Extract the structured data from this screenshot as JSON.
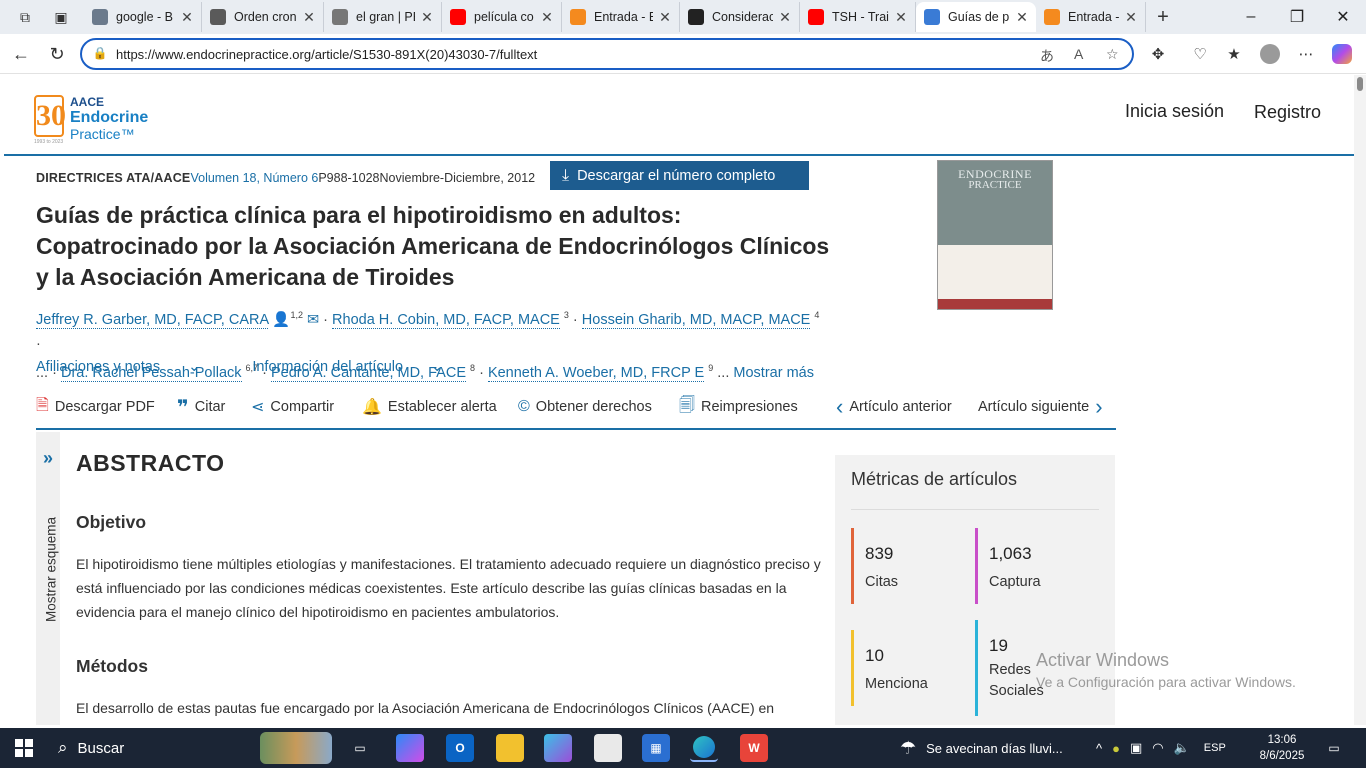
{
  "browser": {
    "tabs": [
      {
        "label": "google - B",
        "icon": "search-icon",
        "color": "#6b7a8c"
      },
      {
        "label": "Orden cron",
        "icon": "doc-icon",
        "color": "#5a5a5a"
      },
      {
        "label": "el gran | PE",
        "icon": "image-icon",
        "color": "#777777"
      },
      {
        "label": "película co",
        "icon": "youtube-icon",
        "color": "#ff0000"
      },
      {
        "label": "Entrada - E",
        "icon": "blogger-icon",
        "color": "#f48a1e"
      },
      {
        "label": "Considerac",
        "icon": "chatgpt-icon",
        "color": "#222222"
      },
      {
        "label": "TSH - Train",
        "icon": "youtube-icon",
        "color": "#ff0000"
      },
      {
        "label": "Guías de p",
        "icon": "aace-icon",
        "color": "#3a7bd5",
        "active": true
      },
      {
        "label": "Entrada - E",
        "icon": "blogger-icon",
        "color": "#f48a1e"
      }
    ],
    "url": "https://www.endocrinepractice.org/article/S1530-891X(20)43030-7/fulltext"
  },
  "site": {
    "logo_aace": "AACE",
    "logo_endocrine": "Endocrine",
    "logo_practice": "Practice™",
    "logo_num": "30",
    "logo_years": "1993 to 2023",
    "login": "Inicia sesión",
    "register": "Registro"
  },
  "article": {
    "type": "DIRECTRICES ATA/AACE",
    "volume": "Volumen 18, Número 6",
    "pages": "P988-1028",
    "date": "Noviembre-Diciembre, 2012",
    "download_issue": "Descargar el número completo",
    "cover_title": "ENDOCRINE",
    "cover_subtitle": "PRACTICE",
    "title": "Guías de práctica clínica para el hipotiroidismo en adultos: Copatrocinado por la Asociación Americana de Endocrinólogos Clínicos y la Asociación Americana de Tiroides",
    "authors": [
      {
        "name": "Jeffrey R. Garber, MD, FACP, CARA",
        "sup": "1,2"
      },
      {
        "name": "Rhoda H. Cobin, MD, FACP, MACE",
        "sup": "3"
      },
      {
        "name": "Hossein Gharib, MD, MACP, MACE",
        "sup": "4"
      },
      {
        "name": "Dra. Rachel Pessah-Pollack",
        "sup": "6,7"
      },
      {
        "name": "Pedro A. Cantante, MD, FACE",
        "sup": "8"
      },
      {
        "name": "Kenneth A. Woeber, MD, FRCP E",
        "sup": "9"
      }
    ],
    "more": "Mostrar más",
    "ellipsis": "...",
    "affiliations": "Afiliaciones y notas",
    "article_info": "Información del artículo"
  },
  "toolbar": {
    "pdf": "Descargar PDF",
    "cite": "Citar",
    "share": "Compartir",
    "alert": "Establecer alerta",
    "rights": "Obtener derechos",
    "reprints": "Reimpresiones",
    "prev": "Artículo anterior",
    "next": "Artículo siguiente"
  },
  "outline": {
    "label": "Mostrar esquema"
  },
  "abstract": {
    "heading": "ABSTRACTO",
    "objective_h": "Objetivo",
    "objective": "El hipotiroidismo tiene múltiples etiologías y manifestaciones. El tratamiento adecuado requiere un diagnóstico preciso y está influenciado por las condiciones médicas coexistentes. Este artículo describe las guías clínicas basadas en la evidencia para el manejo clínico del hipotiroidismo en pacientes ambulatorios.",
    "methods_h": "Métodos",
    "methods": "El desarrollo de estas pautas fue encargado por la Asociación Americana de Endocrinólogos Clínicos (AACE) en"
  },
  "metrics": {
    "title": "Métricas de artículos",
    "items": [
      {
        "value": "839",
        "label": "Citas",
        "color": "#e0643a"
      },
      {
        "value": "1,063",
        "label": "Captura",
        "color": "#c94fc9"
      },
      {
        "value": "10",
        "label": "Menciona",
        "color": "#f2c12e"
      },
      {
        "value": "19",
        "label": "Redes Sociales",
        "color": "#2bb3d9"
      }
    ]
  },
  "watermark": {
    "line1": "Activar Windows",
    "line2": "Ve a Configuración para activar Windows."
  },
  "taskbar": {
    "search": "Buscar",
    "weather": "Se avecinan días lluvi...",
    "lang": "ESP",
    "time": "13:06",
    "date": "8/6/2025"
  }
}
